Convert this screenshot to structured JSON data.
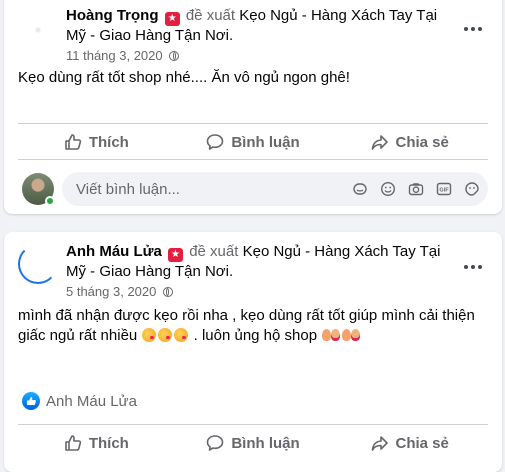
{
  "posts": [
    {
      "author": "Hoàng Trọng",
      "verb": "đề xuất",
      "page": "Kẹo Ngủ - Hàng Xách Tay Tại Mỹ - Giao Hàng Tận Nơi.",
      "date": "11 tháng 3, 2020",
      "text": "Kẹo dùng rất tốt shop nhé.... Ăn vô ngủ ngon ghê!"
    },
    {
      "author": "Anh Máu Lửa",
      "verb": "đề xuất",
      "page": "Kẹo Ngủ - Hàng Xách Tay Tại Mỹ - Giao Hàng Tận Nơi.",
      "date": "5 tháng 3, 2020",
      "text_part1": "mình đã nhận được kẹo rồi nha , kẹo dùng rất tốt giúp mình cải thiện giấc ngủ rất nhiều",
      "text_part2": ". luôn ủng hộ shop",
      "reactor": "Anh Máu Lửa"
    }
  ],
  "actions": {
    "like": "Thích",
    "comment": "Bình luận",
    "share": "Chia sẻ"
  },
  "comment_box": {
    "placeholder": "Viết bình luận..."
  },
  "icons": {
    "recommend": "recommend-star-icon",
    "privacy": "globe-icon",
    "more": "more-options-icon",
    "comment_tools": [
      "sticker-icon",
      "emoji-icon",
      "camera-icon",
      "gif-icon",
      "sticker-face-icon"
    ]
  },
  "colors": {
    "accent": "#1b74e4",
    "recommend": "#e41e3f",
    "muted": "#65676b",
    "background": "#f0f2f5"
  }
}
